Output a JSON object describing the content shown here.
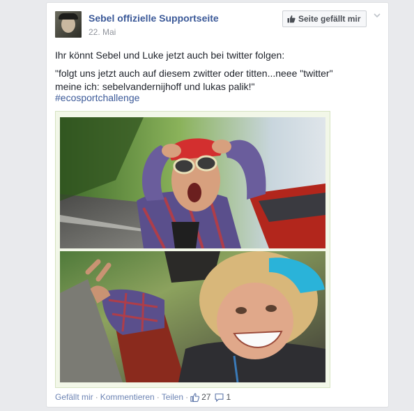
{
  "post": {
    "page_name": "Sebel offizielle Supportseite",
    "date": "22. Mai",
    "like_page_button": "Seite gefällt mir",
    "text_line1": "Ihr könnt Sebel und Luke jetzt auch bei twitter folgen:",
    "text_line2": "\"folgt uns jetzt auch auf diesem zwitter oder titten...neee \"twitter\"",
    "text_line3": "meine ich: sebelvandernijhoff und lukas palik!\"",
    "hashtag": "#ecosportchallenge"
  },
  "footer": {
    "like": "Gefällt mir",
    "comment": "Kommentieren",
    "share": "Teilen",
    "like_count": "27",
    "comment_count": "1"
  },
  "icons": {
    "like_page": "thumbs-up-icon",
    "menu": "chevron-down-icon",
    "likes": "thumbs-up-icon",
    "comments": "comment-bubble-icon"
  },
  "colors": {
    "link": "#3b5998",
    "background": "#e9eaed"
  }
}
